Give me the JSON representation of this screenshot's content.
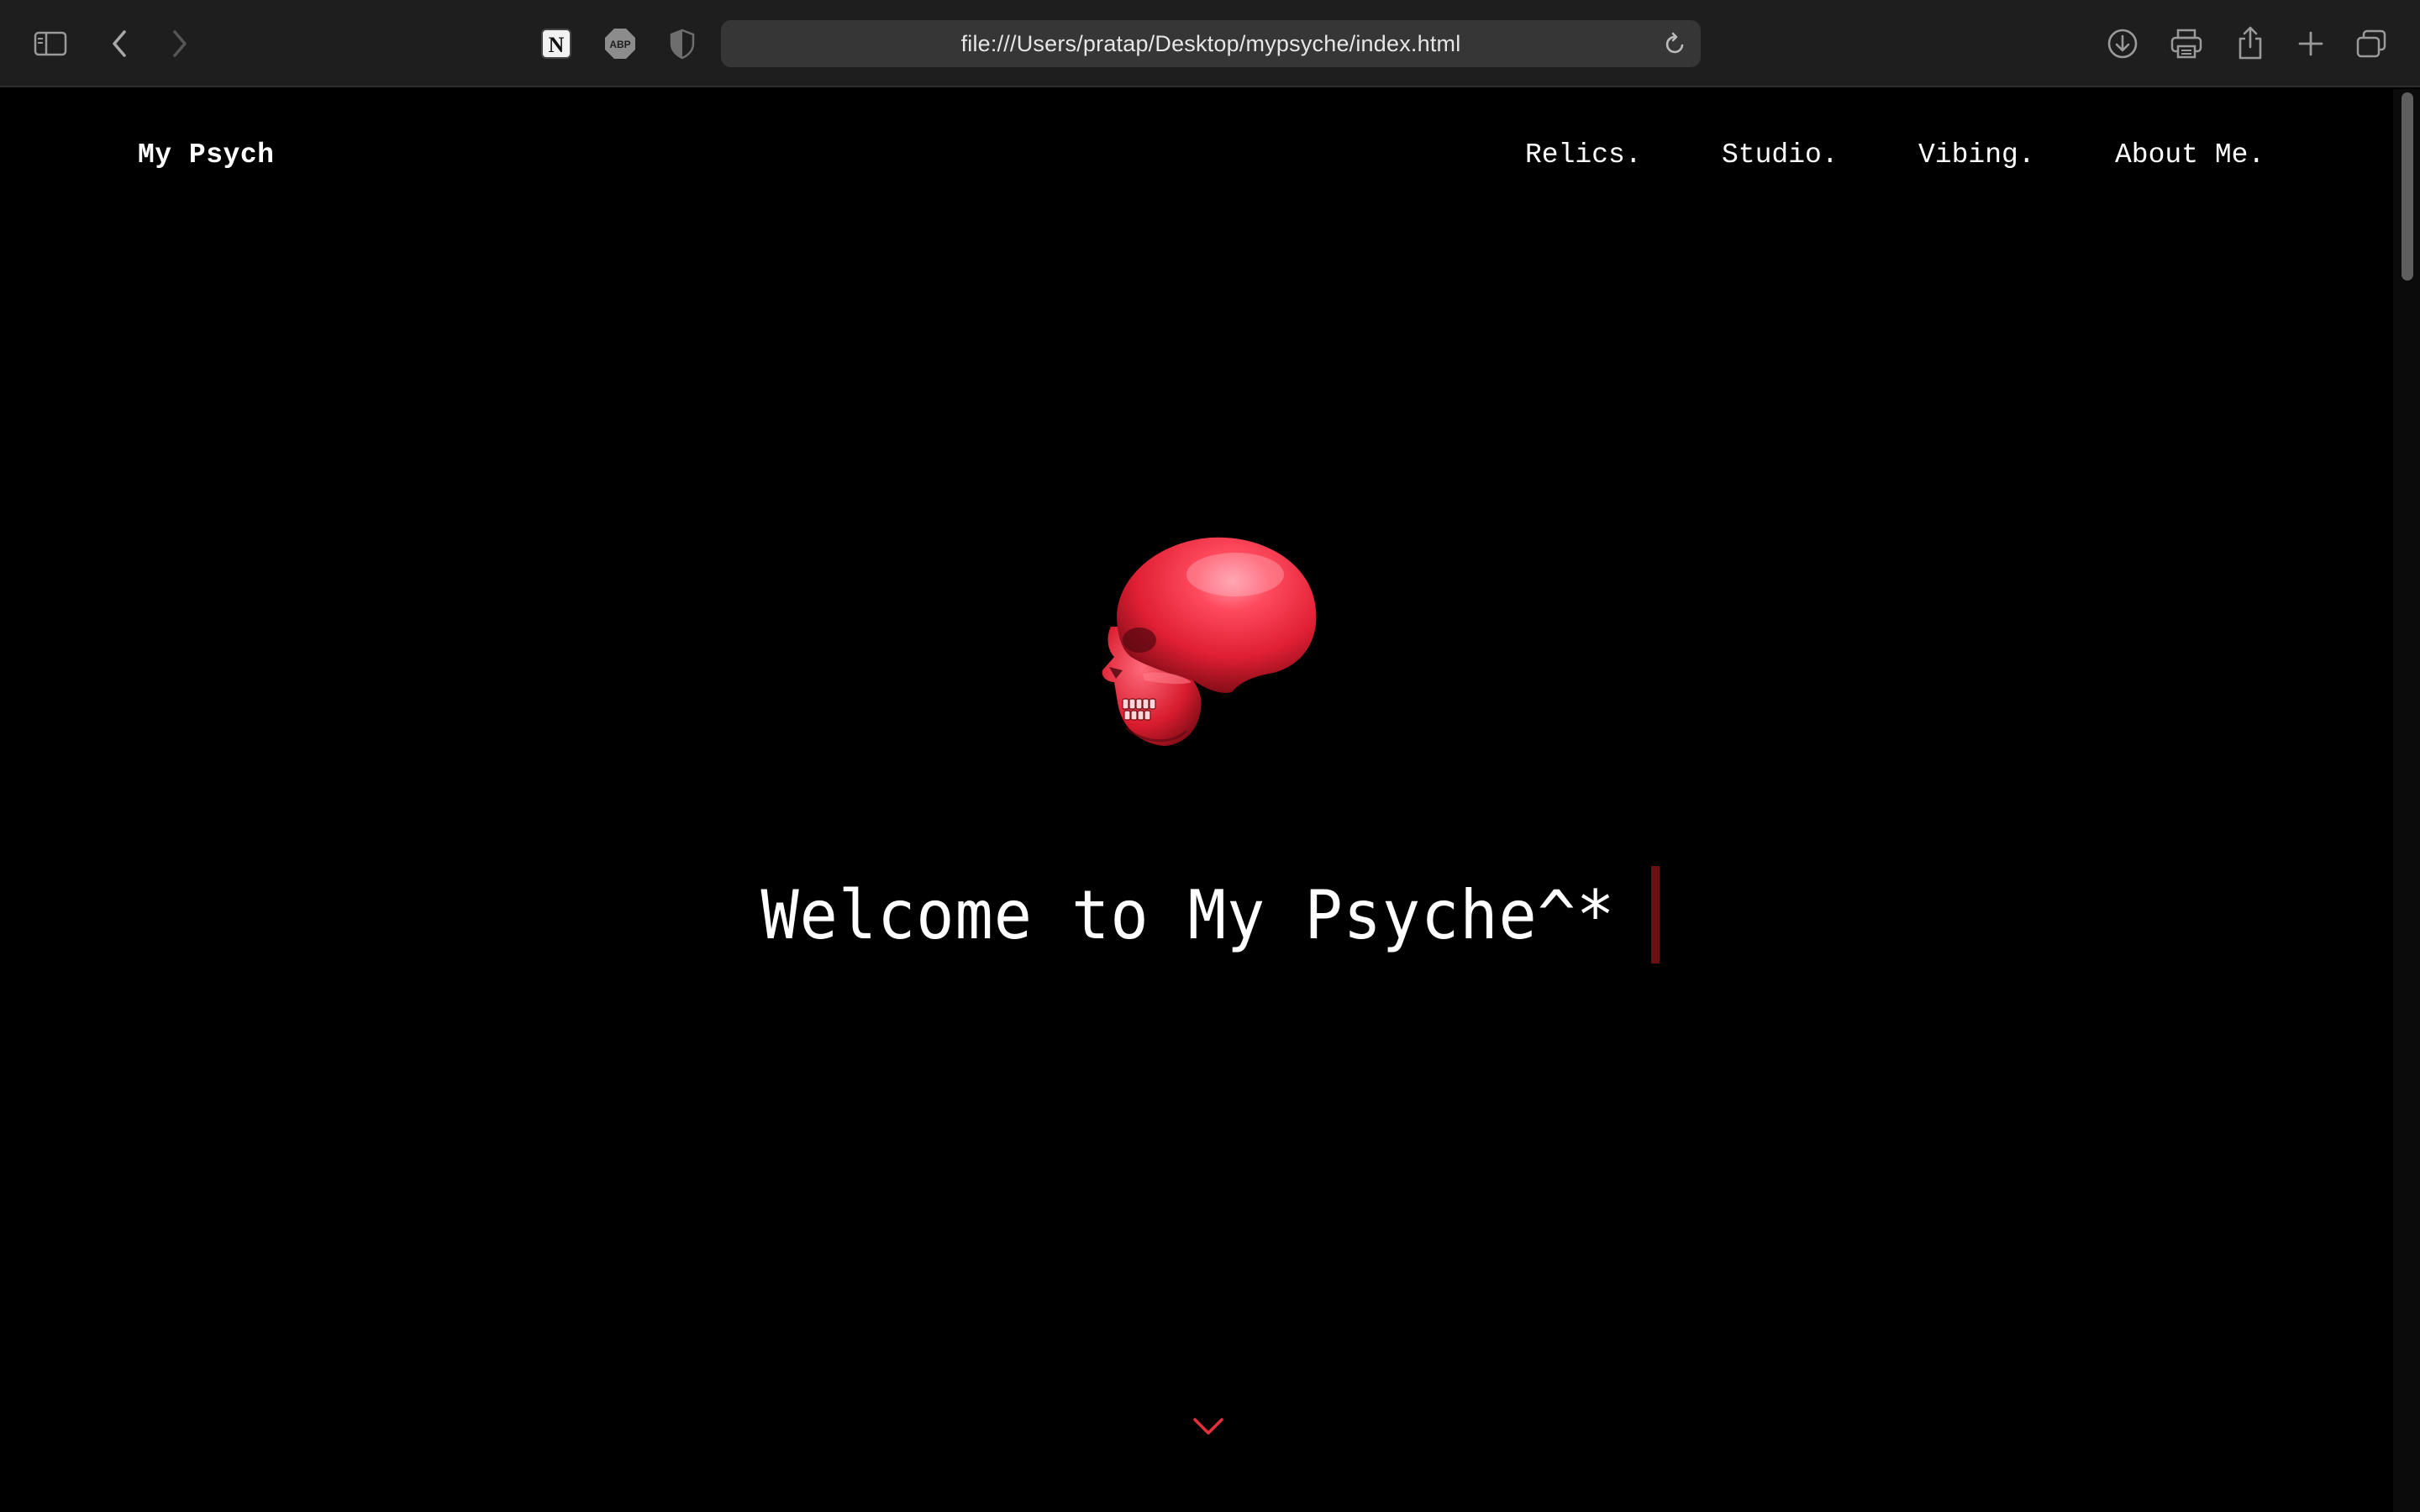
{
  "browser": {
    "url": "file:///Users/pratap/Desktop/mypsyche/index.html",
    "toolbar_icons": [
      "sidebar-icon",
      "back-icon",
      "forward-icon",
      "notion-extension-icon",
      "adblock-plus-icon",
      "privacy-shield-icon",
      "reload-icon",
      "downloads-icon",
      "print-icon",
      "share-icon",
      "new-tab-icon",
      "tab-overview-icon"
    ],
    "extension_abp_label": "ABP",
    "extension_notion_label": "N"
  },
  "site": {
    "logo": "My Psych",
    "nav": [
      {
        "label": "Relics."
      },
      {
        "label": "Studio."
      },
      {
        "label": "Vibing."
      },
      {
        "label": "About Me."
      }
    ]
  },
  "hero": {
    "image": "red-skull-icon",
    "heading": "Welcome to My Psyche^*",
    "scroll_icon": "chevron-down-icon"
  },
  "colors": {
    "background": "#000000",
    "chrome": "#1e1e1e",
    "accent_red": "#e8303c",
    "caret": "#6a1212"
  }
}
